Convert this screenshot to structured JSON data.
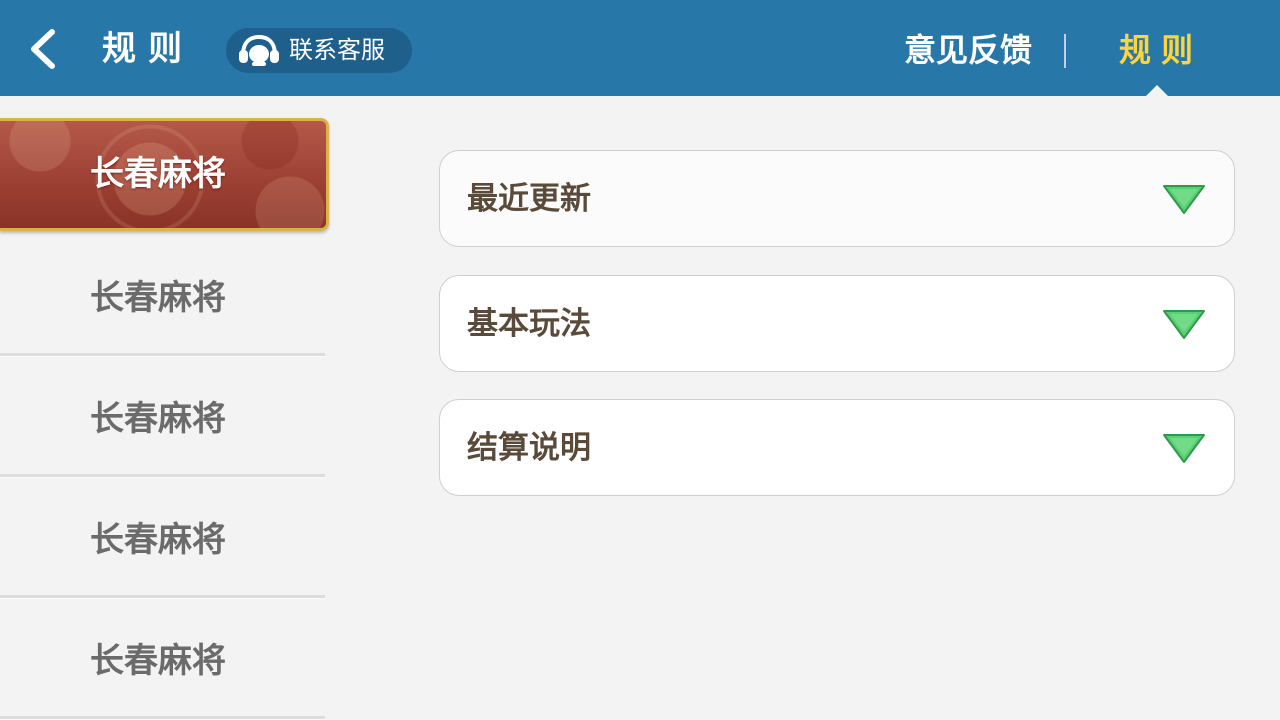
{
  "header": {
    "back_icon": "chevron-left-icon",
    "title": "规则",
    "contact_button": {
      "icon": "headset-icon",
      "label": "联系客服"
    },
    "tabs": [
      {
        "label": "意见反馈",
        "active": false
      },
      {
        "label": "规则",
        "active": true
      }
    ]
  },
  "sidebar": {
    "items": [
      {
        "label": "长春麻将",
        "active": true
      },
      {
        "label": "长春麻将",
        "active": false
      },
      {
        "label": "长春麻将",
        "active": false
      },
      {
        "label": "长春麻将",
        "active": false
      },
      {
        "label": "长春麻将",
        "active": false
      }
    ]
  },
  "main": {
    "sections": [
      {
        "label": "最近更新",
        "icon": "triangle-down-icon"
      },
      {
        "label": "基本玩法",
        "icon": "triangle-down-icon"
      },
      {
        "label": "结算说明",
        "icon": "triangle-down-icon"
      }
    ]
  },
  "colors": {
    "header_bg": "#2777a8",
    "active_tab": "#ffd53a",
    "page_bg": "#f3f3f3",
    "arrow_green": "#5ccf75",
    "active_sidebar": "#a84a3c"
  }
}
